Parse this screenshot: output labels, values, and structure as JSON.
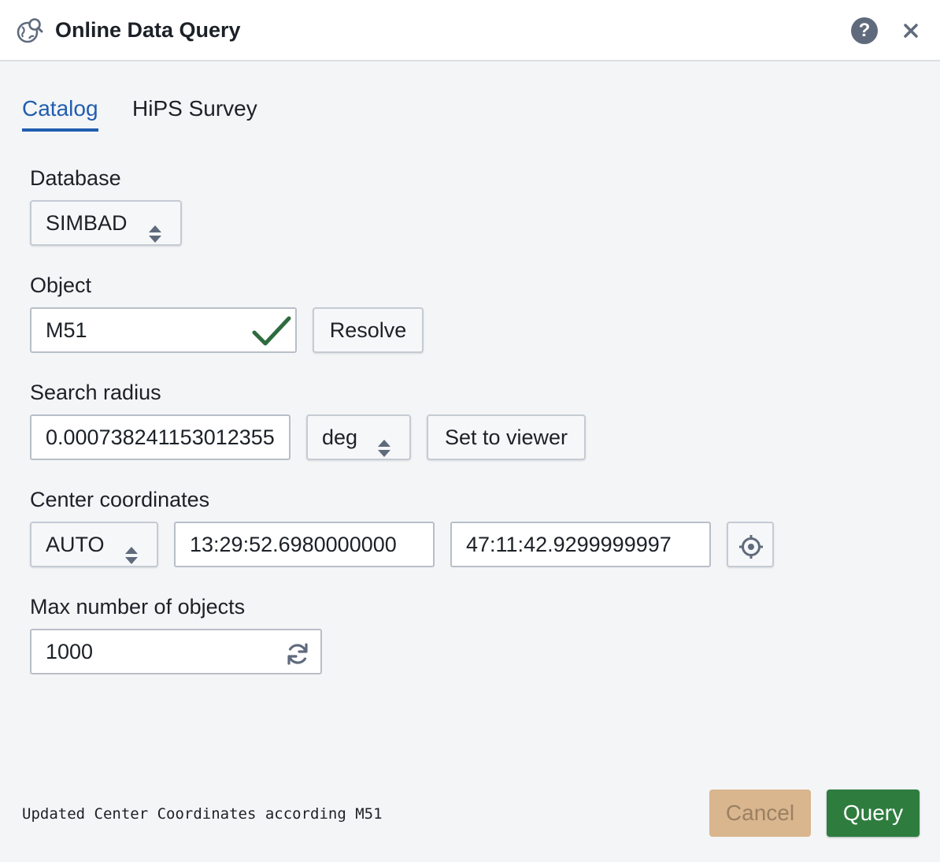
{
  "dialog": {
    "title": "Online Data Query",
    "icon": "globe-search-icon",
    "help_icon": "help-icon",
    "help_text": "?",
    "close_icon": "close-icon"
  },
  "tabs": [
    {
      "label": "Catalog",
      "active": true
    },
    {
      "label": "HiPS Survey",
      "active": false
    }
  ],
  "form": {
    "database": {
      "label": "Database",
      "value": "SIMBAD"
    },
    "object": {
      "label": "Object",
      "value": "M51",
      "status_icon": "check-icon",
      "resolve_label": "Resolve"
    },
    "search_radius": {
      "label": "Search radius",
      "value": "0.0007382411530123553",
      "unit": "deg",
      "set_to_viewer_label": "Set to viewer"
    },
    "center_coordinates": {
      "label": "Center coordinates",
      "system": "AUTO",
      "ra": "13:29:52.6980000000",
      "dec": "47:11:42.9299999997",
      "target_icon": "crosshair-icon"
    },
    "max_objects": {
      "label": "Max number of objects",
      "value": "1000",
      "reset_icon": "refresh-icon"
    }
  },
  "footer": {
    "status_message": "Updated Center Coordinates according M51",
    "cancel_label": "Cancel",
    "query_label": "Query"
  },
  "colors": {
    "accent": "#215db0",
    "query_button": "#2e7d3f",
    "cancel_button_disabled": "#d9b68e",
    "success_check": "#2e6b3f",
    "help_icon_bg": "#5f6b7c"
  }
}
